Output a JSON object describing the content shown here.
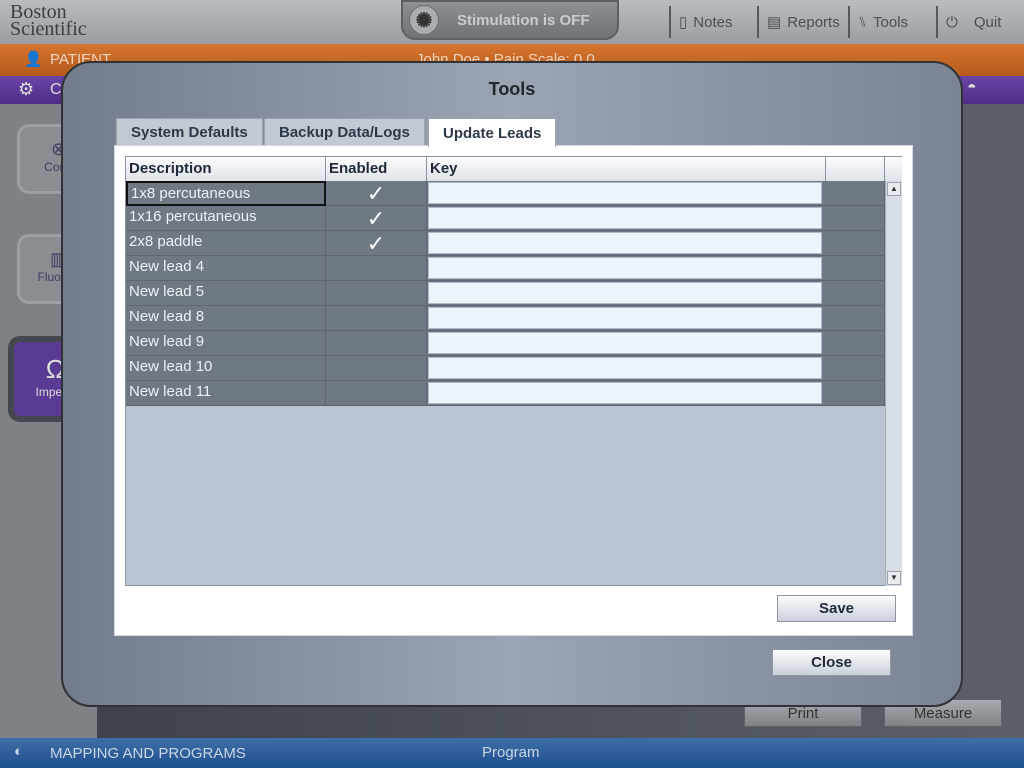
{
  "header": {
    "logo": "Boston Scientific",
    "stimulation": "Stimulation is OFF",
    "buttons": [
      {
        "label": "Notes",
        "icon": "notes-icon"
      },
      {
        "label": "Reports",
        "icon": "reports-icon"
      },
      {
        "label": "Tools",
        "icon": "tools-icon"
      },
      {
        "label": "Quit",
        "icon": "power-icon"
      }
    ]
  },
  "patient": {
    "label": "PATIENT",
    "info": "John Doe • Pain Scale: 0.0"
  },
  "purplebar": {
    "label": "C"
  },
  "sidebar": {
    "items": [
      {
        "label": "Conn"
      },
      {
        "label": "FluoroS"
      },
      {
        "label": "Impeda"
      }
    ]
  },
  "main": {
    "print": "Print",
    "measure": "Measure"
  },
  "bottom": {
    "section": "MAPPING AND PROGRAMS",
    "program": "Program"
  },
  "modal": {
    "title": "Tools",
    "tabs": [
      {
        "label": "System Defaults"
      },
      {
        "label": "Backup Data/Logs"
      },
      {
        "label": "Update Leads",
        "active": true
      }
    ],
    "table": {
      "columns": [
        "Description",
        "Enabled",
        "Key",
        ""
      ],
      "rows": [
        {
          "description": "1x8 percutaneous",
          "enabled": true,
          "key": ""
        },
        {
          "description": "1x16 percutaneous",
          "enabled": true,
          "key": ""
        },
        {
          "description": "2x8 paddle",
          "enabled": true,
          "key": ""
        },
        {
          "description": "New lead  4",
          "enabled": false,
          "key": ""
        },
        {
          "description": "New lead  5",
          "enabled": false,
          "key": ""
        },
        {
          "description": "New lead  8",
          "enabled": false,
          "key": ""
        },
        {
          "description": "New lead  9",
          "enabled": false,
          "key": ""
        },
        {
          "description": "New lead  10",
          "enabled": false,
          "key": ""
        },
        {
          "description": "New lead  11",
          "enabled": false,
          "key": ""
        }
      ]
    },
    "save": "Save",
    "close": "Close",
    "check_glyph": "✓"
  },
  "colors": {
    "patient": "#c8651f",
    "purple": "#5a3795",
    "bottom": "#2a5c99"
  }
}
